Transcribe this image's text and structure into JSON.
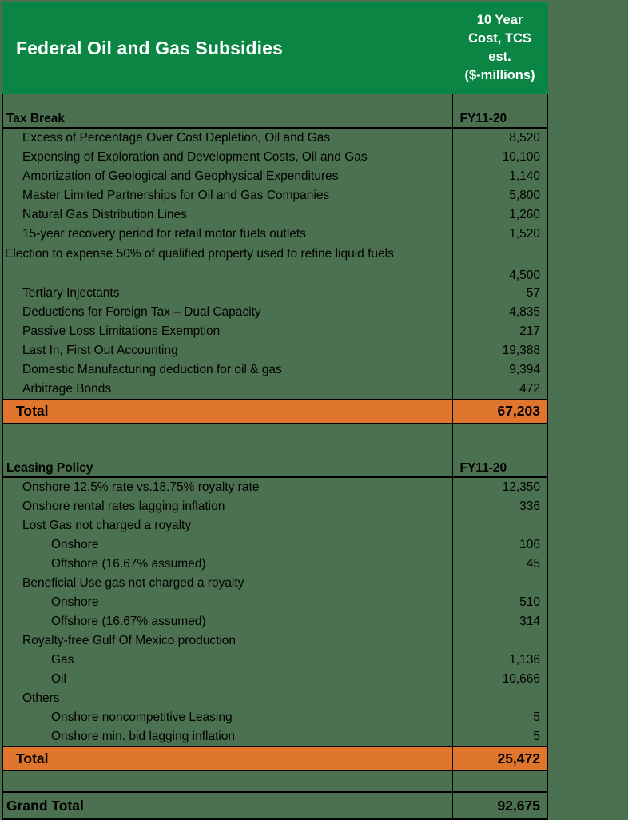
{
  "header": {
    "title": "Federal Oil and Gas Subsidies",
    "unit_lines": [
      "10 Year",
      "Cost, TCS",
      "est.",
      "($-millions)"
    ],
    "accent_green": "#0a8543",
    "accent_orange": "#e0752d",
    "background": "#4b7150"
  },
  "sections": [
    {
      "name": "tax-break",
      "header_label": "Tax Break",
      "header_value": "FY11-20",
      "rows": [
        {
          "label": "Excess of Percentage Over Cost Depletion, Oil and Gas",
          "value": "8,520",
          "indent": 1
        },
        {
          "label": "Expensing of Exploration and Development Costs, Oil and Gas",
          "value": "10,100",
          "indent": 1
        },
        {
          "label": "Amortization of Geological and Geophysical Expenditures",
          "value": "1,140",
          "indent": 1
        },
        {
          "label": "Master Limited Partnerships for Oil and Gas Companies",
          "value": "5,800",
          "indent": 1
        },
        {
          "label": "Natural Gas Distribution Lines",
          "value": "1,260",
          "indent": 1
        },
        {
          "label": "15-year recovery period for retail motor fuels outlets",
          "value": "1,520",
          "indent": 1
        },
        {
          "label": "Election to expense 50% of qualified property used to refine liquid fuels",
          "value": "4,500",
          "indent": 1,
          "wrap": true
        },
        {
          "label": "Tertiary Injectants",
          "value": "57",
          "indent": 1
        },
        {
          "label": "Deductions for Foreign Tax – Dual Capacity",
          "value": "4,835",
          "indent": 1
        },
        {
          "label": "Passive Loss Limitations Exemption",
          "value": "217",
          "indent": 1
        },
        {
          "label": "Last In, First Out Accounting",
          "value": "19,388",
          "indent": 1
        },
        {
          "label": "Domestic Manufacturing deduction for oil & gas",
          "value": "9,394",
          "indent": 1
        },
        {
          "label": "Arbitrage Bonds",
          "value": "472",
          "indent": 1
        }
      ],
      "total_label": "Total",
      "total_value": "67,203"
    },
    {
      "name": "leasing-policy",
      "header_label": "Leasing Policy",
      "header_value": "FY11-20",
      "rows": [
        {
          "label": "Onshore 12.5% rate vs.18.75% royalty rate",
          "value": "12,350",
          "indent": 1
        },
        {
          "label": "Onshore rental rates lagging inflation",
          "value": "336",
          "indent": 1
        },
        {
          "label": "Lost Gas not charged a royalty",
          "value": "",
          "indent": 1
        },
        {
          "label": "Onshore",
          "value": "106",
          "indent": 2
        },
        {
          "label": "Offshore (16.67% assumed)",
          "value": "45",
          "indent": 2
        },
        {
          "label": "Beneficial Use gas not charged a royalty",
          "value": "",
          "indent": 1
        },
        {
          "label": "Onshore",
          "value": "510",
          "indent": 2
        },
        {
          "label": "Offshore (16.67% assumed)",
          "value": "314",
          "indent": 2
        },
        {
          "label": "Royalty-free Gulf Of Mexico production",
          "value": "",
          "indent": 1
        },
        {
          "label": "Gas",
          "value": "1,136",
          "indent": 2
        },
        {
          "label": "Oil",
          "value": "10,666",
          "indent": 2
        },
        {
          "label": "Others",
          "value": "",
          "indent": 1
        },
        {
          "label": "Onshore noncompetitive Leasing",
          "value": "5",
          "indent": 2
        },
        {
          "label": "Onshore min. bid lagging inflation",
          "value": "5",
          "indent": 2
        }
      ],
      "total_label": "Total",
      "total_value": "25,472"
    }
  ],
  "grand_total": {
    "label": "Grand Total",
    "value": "92,675"
  }
}
